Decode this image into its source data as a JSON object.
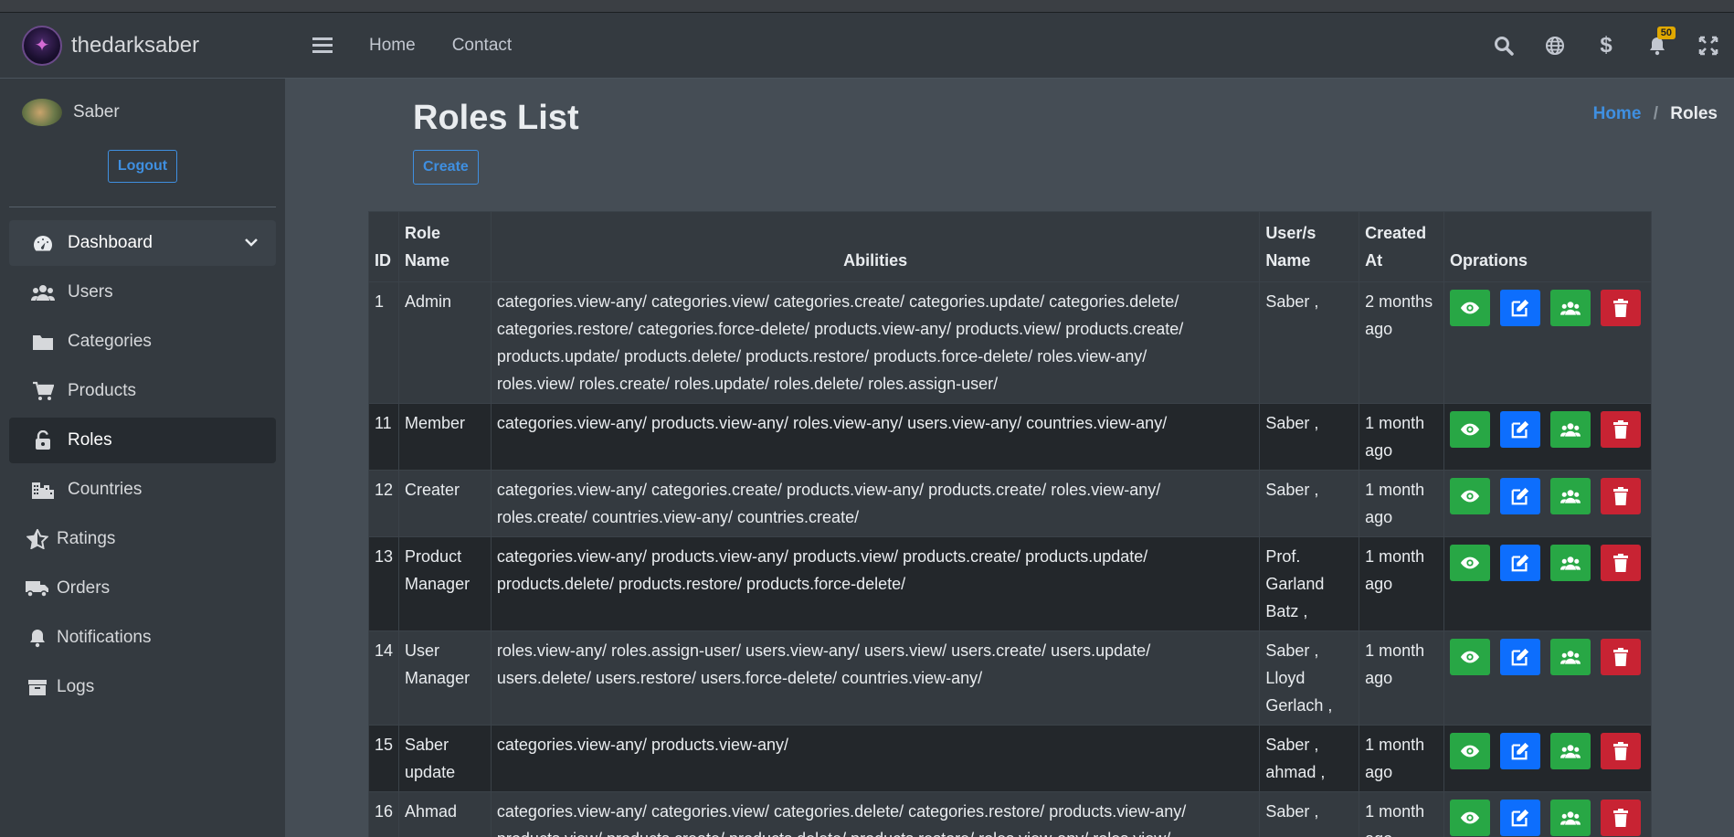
{
  "app": {
    "brand": "thedarksaber"
  },
  "user": {
    "name": "Saber",
    "logout_label": "Logout"
  },
  "sidebar": {
    "items": [
      {
        "label": "Dashboard",
        "icon": "tachometer-icon"
      },
      {
        "label": "Users",
        "icon": "users-icon"
      },
      {
        "label": "Categories",
        "icon": "folder-icon"
      },
      {
        "label": "Products",
        "icon": "cart-icon"
      },
      {
        "label": "Roles",
        "icon": "unlock-icon"
      },
      {
        "label": "Countries",
        "icon": "city-icon"
      },
      {
        "label": "Ratings",
        "icon": "star-icon"
      },
      {
        "label": "Orders",
        "icon": "truck-icon"
      },
      {
        "label": "Notifications",
        "icon": "bell-icon"
      },
      {
        "label": "Logs",
        "icon": "archive-icon"
      }
    ]
  },
  "topbar": {
    "links": [
      "Home",
      "Contact"
    ],
    "notifications_count": "50"
  },
  "page": {
    "title": "Roles List",
    "create_label": "Create",
    "breadcrumb": {
      "home": "Home",
      "separator": "/",
      "current": "Roles"
    }
  },
  "table": {
    "headers": {
      "id": "ID",
      "role_name_1": "Role",
      "role_name_2": "Name",
      "abilities": "Abilities",
      "users_1": "User/s",
      "users_2": "Name",
      "created_1": "Created",
      "created_2": "At",
      "ops": "Oprations"
    },
    "rows": [
      {
        "id": "1",
        "name": [
          "Admin"
        ],
        "abilities": [
          "categories.view-any/ categories.view/ categories.create/ categories.update/ categories.delete/",
          "categories.restore/ categories.force-delete/ products.view-any/ products.view/ products.create/",
          "products.update/ products.delete/ products.restore/ products.force-delete/ roles.view-any/",
          "roles.view/ roles.create/ roles.update/ roles.delete/ roles.assign-user/"
        ],
        "users": [
          "Saber ,"
        ],
        "created": [
          "2 months",
          "ago"
        ]
      },
      {
        "id": "11",
        "name": [
          "Member"
        ],
        "abilities": [
          "categories.view-any/ products.view-any/ roles.view-any/ users.view-any/ countries.view-any/"
        ],
        "users": [
          "Saber ,"
        ],
        "created": [
          "1 month",
          "ago"
        ]
      },
      {
        "id": "12",
        "name": [
          "Creater"
        ],
        "abilities": [
          "categories.view-any/ categories.create/ products.view-any/ products.create/ roles.view-any/",
          "roles.create/ countries.view-any/ countries.create/"
        ],
        "users": [
          "Saber ,"
        ],
        "created": [
          "1 month",
          "ago"
        ]
      },
      {
        "id": "13",
        "name": [
          "Product",
          "Manager"
        ],
        "abilities": [
          "categories.view-any/ products.view-any/ products.view/ products.create/ products.update/",
          "products.delete/ products.restore/ products.force-delete/"
        ],
        "users": [
          "Prof.",
          "Garland",
          "Batz ,"
        ],
        "created": [
          "1 month",
          "ago"
        ]
      },
      {
        "id": "14",
        "name": [
          "User",
          "Manager"
        ],
        "abilities": [
          "roles.view-any/ roles.assign-user/ users.view-any/ users.view/ users.create/ users.update/",
          "users.delete/ users.restore/ users.force-delete/ countries.view-any/"
        ],
        "users": [
          "Saber ,",
          "Lloyd",
          "Gerlach ,"
        ],
        "created": [
          "1 month",
          "ago"
        ]
      },
      {
        "id": "15",
        "name": [
          "Saber",
          "update"
        ],
        "abilities": [
          "categories.view-any/ products.view-any/"
        ],
        "users": [
          "Saber ,",
          "ahmad ,"
        ],
        "created": [
          "1 month",
          "ago"
        ]
      },
      {
        "id": "16",
        "name": [
          "Ahmad"
        ],
        "abilities": [
          "categories.view-any/ categories.view/ categories.delete/ categories.restore/ products.view-any/",
          "products.view/ products.create/ products.delete/ products.restore/ roles.view-any/ roles.view/"
        ],
        "users": [
          "Saber ,"
        ],
        "created": [
          "1 month",
          "ago"
        ]
      }
    ],
    "op_buttons": [
      {
        "name": "view-button",
        "icon": "eye-icon",
        "color": "#28a745"
      },
      {
        "name": "edit-button",
        "icon": "edit-icon",
        "color": "#0d6efd"
      },
      {
        "name": "assign-users-button",
        "icon": "users-icon",
        "color": "#28a745"
      },
      {
        "name": "delete-button",
        "icon": "trash-icon",
        "color": "#c82333"
      }
    ]
  },
  "colors": {
    "sidebar_bg": "#343a40",
    "content_bg": "#454d55",
    "accent_blue": "#3f8fe0",
    "success": "#28a745",
    "danger": "#c82333",
    "primary": "#0d6efd",
    "badge": "#e0a800"
  }
}
